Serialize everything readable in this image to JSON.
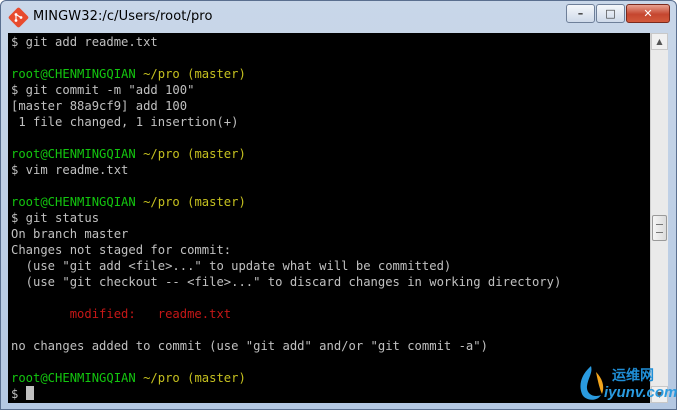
{
  "window": {
    "title": "MINGW32:/c/Users/root/pro",
    "controls": {
      "minimize": "–",
      "maximize": "□",
      "close": "✕"
    }
  },
  "terminal": {
    "lines": [
      [
        {
          "text": "$ git add readme.txt",
          "color": "white"
        }
      ],
      [
        {
          "text": "",
          "color": "white"
        }
      ],
      [
        {
          "text": "root@CHENMINGQIAN ",
          "color": "green"
        },
        {
          "text": "~/pro (master)",
          "color": "yellow"
        }
      ],
      [
        {
          "text": "$ git commit -m \"add 100\"",
          "color": "white"
        }
      ],
      [
        {
          "text": "[master 88a9cf9] add 100",
          "color": "white"
        }
      ],
      [
        {
          "text": " 1 file changed, 1 insertion(+)",
          "color": "white"
        }
      ],
      [
        {
          "text": "",
          "color": "white"
        }
      ],
      [
        {
          "text": "root@CHENMINGQIAN ",
          "color": "green"
        },
        {
          "text": "~/pro (master)",
          "color": "yellow"
        }
      ],
      [
        {
          "text": "$ vim readme.txt",
          "color": "white"
        }
      ],
      [
        {
          "text": "",
          "color": "white"
        }
      ],
      [
        {
          "text": "root@CHENMINGQIAN ",
          "color": "green"
        },
        {
          "text": "~/pro (master)",
          "color": "yellow"
        }
      ],
      [
        {
          "text": "$ git status",
          "color": "white"
        }
      ],
      [
        {
          "text": "On branch master",
          "color": "white"
        }
      ],
      [
        {
          "text": "Changes not staged for commit:",
          "color": "white"
        }
      ],
      [
        {
          "text": "  (use \"git add <file>...\" to update what will be committed)",
          "color": "white"
        }
      ],
      [
        {
          "text": "  (use \"git checkout -- <file>...\" to discard changes in working directory)",
          "color": "white"
        }
      ],
      [
        {
          "text": "",
          "color": "white"
        }
      ],
      [
        {
          "text": "        modified:   readme.txt",
          "color": "red"
        }
      ],
      [
        {
          "text": "",
          "color": "white"
        }
      ],
      [
        {
          "text": "no changes added to commit (use \"git add\" and/or \"git commit -a\")",
          "color": "white"
        }
      ],
      [
        {
          "text": "",
          "color": "white"
        }
      ],
      [
        {
          "text": "root@CHENMINGQIAN ",
          "color": "green"
        },
        {
          "text": "~/pro (master)",
          "color": "yellow"
        }
      ],
      [
        {
          "text": "$ ",
          "color": "white"
        }
      ]
    ],
    "colors": {
      "white": "#c0c0c0",
      "green": "#13c60f",
      "yellow": "#c5c01f",
      "red": "#c51717"
    }
  },
  "scrollbar": {
    "up_arrow": "▲",
    "down_arrow": "▼"
  },
  "watermark": {
    "name": "运维网",
    "domain": "iyunv.com"
  }
}
